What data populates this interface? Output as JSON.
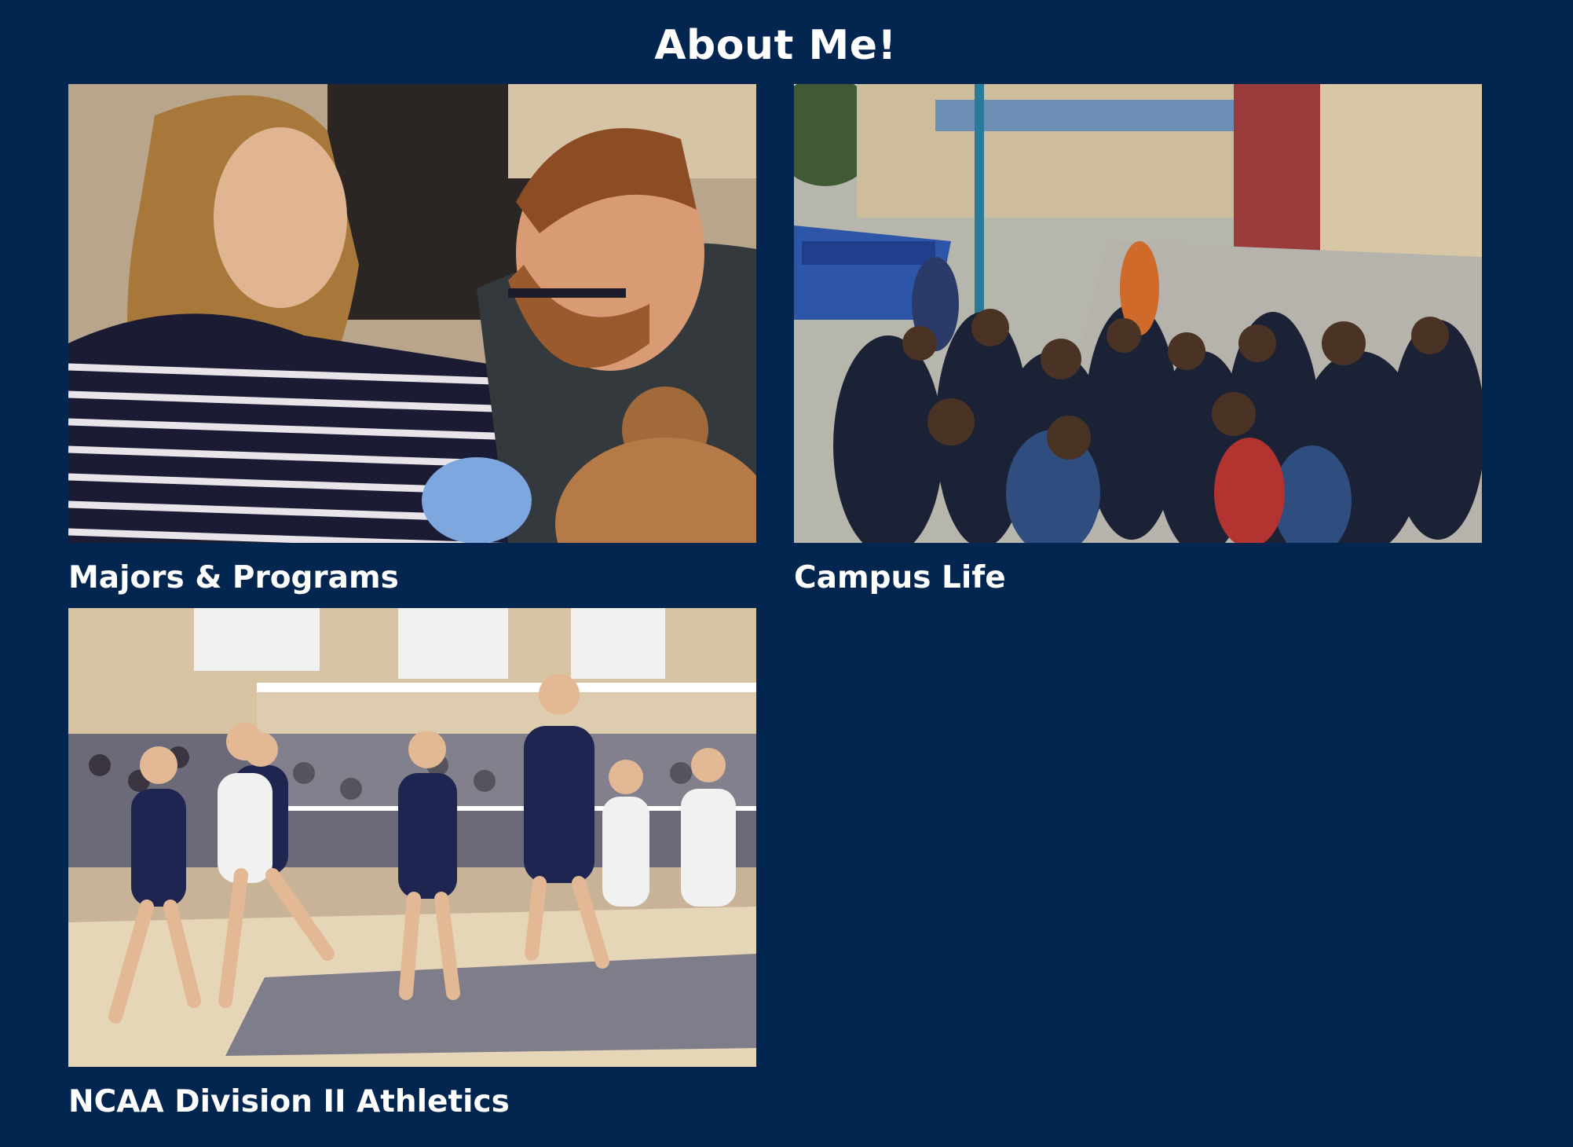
{
  "section": {
    "title": "About Me!"
  },
  "cards": [
    {
      "label": "Majors & Programs",
      "image_alt": "Instructor and students examining a lab sample"
    },
    {
      "label": "Campus Life",
      "image_alt": "Crowd of students at an outdoor campus event"
    },
    {
      "label": "NCAA Division II Athletics",
      "image_alt": "Volleyball team celebrating on court"
    }
  ],
  "colors": {
    "background": "#032650",
    "text": "#ffffff"
  }
}
